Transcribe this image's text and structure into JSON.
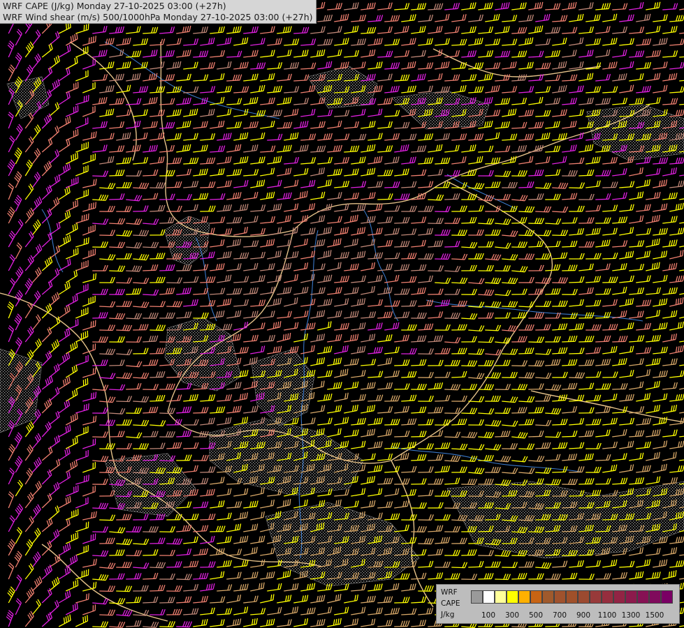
{
  "titles": {
    "line1": "WRF CAPE (J/kg) Monday 27-10-2025 03:00 (+27h)",
    "line2": "WRF Wind shear (m/s) 500/1000hPa Monday 27-10-2025 03:00 (+27h)"
  },
  "legend": {
    "label_model": "WRF",
    "label_field": "CAPE",
    "label_unit": "J/kg",
    "colors": [
      "#9a9a9a",
      "#ffffff",
      "#ffff99",
      "#ffff00",
      "#ffb000",
      "#c86414",
      "#a05a2c",
      "#a0522d",
      "#a0502a",
      "#9c4a30",
      "#983a3a",
      "#962e3e",
      "#922444",
      "#8c1a4c",
      "#861254",
      "#800a5c",
      "#7a0064"
    ],
    "ticks": [
      "100",
      "300",
      "500",
      "700",
      "900",
      "1100",
      "1300",
      "1500"
    ]
  },
  "barb_colors": {
    "yellow": "#ffff00",
    "salmon": "#f08070",
    "magenta": "#e020e0",
    "rose": "#c08878",
    "tan": "#d8a868",
    "violet": "#a050d0"
  },
  "map_colors": {
    "background": "#000000",
    "borders": "#e6c38a",
    "rivers": "#3a78c8",
    "cape_stipple": "#9a9a9a"
  }
}
